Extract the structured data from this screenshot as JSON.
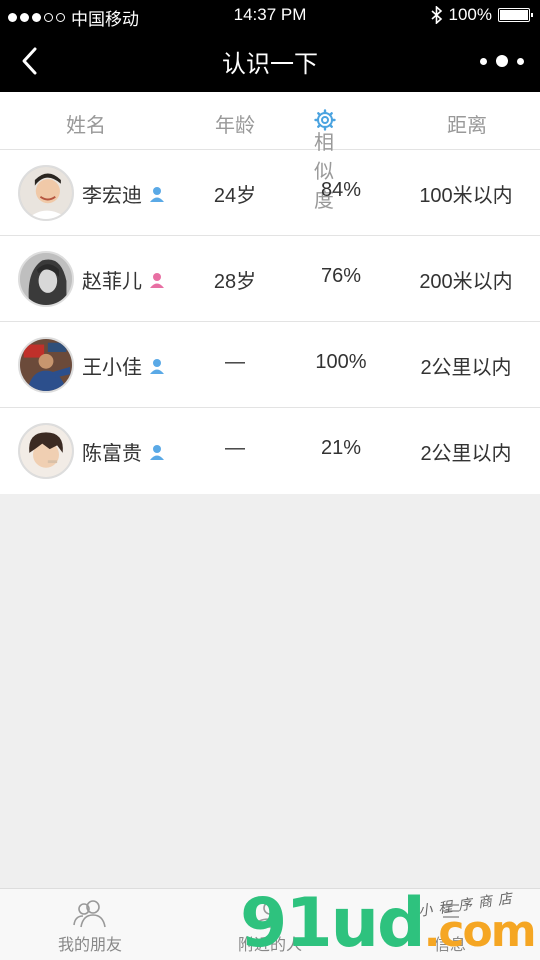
{
  "status_bar": {
    "carrier": "中国移动",
    "time": "14:37 PM",
    "battery": "100%"
  },
  "nav": {
    "title": "认识一下"
  },
  "table": {
    "headers": {
      "name": "姓名",
      "age": "年龄",
      "similarity": "相似度",
      "distance": "距离"
    },
    "rows": [
      {
        "name": "李宏迪",
        "gender": "male",
        "age": "24岁",
        "similarity": "84%",
        "distance": "100米以内"
      },
      {
        "name": "赵菲儿",
        "gender": "female",
        "age": "28岁",
        "similarity": "76%",
        "distance": "200米以内"
      },
      {
        "name": "王小佳",
        "gender": "male",
        "age": "—",
        "similarity": "100%",
        "distance": "2公里以内"
      },
      {
        "name": "陈富贵",
        "gender": "male",
        "age": "—",
        "similarity": "21%",
        "distance": "2公里以内"
      }
    ]
  },
  "tabbar": {
    "tabs": [
      {
        "label": "我的朋友",
        "icon": "friends-icon"
      },
      {
        "label": "附近的人",
        "icon": "nearby-icon"
      },
      {
        "label": "信息",
        "icon": "message-icon"
      }
    ]
  },
  "watermark": {
    "brand_green": "91ud",
    "brand_orange": ".com",
    "tagline": "小程序商店"
  },
  "colors": {
    "male": "#5aa9e6",
    "female": "#e86fa3",
    "accent": "#4aa3e0",
    "nav_bg": "#000000"
  }
}
